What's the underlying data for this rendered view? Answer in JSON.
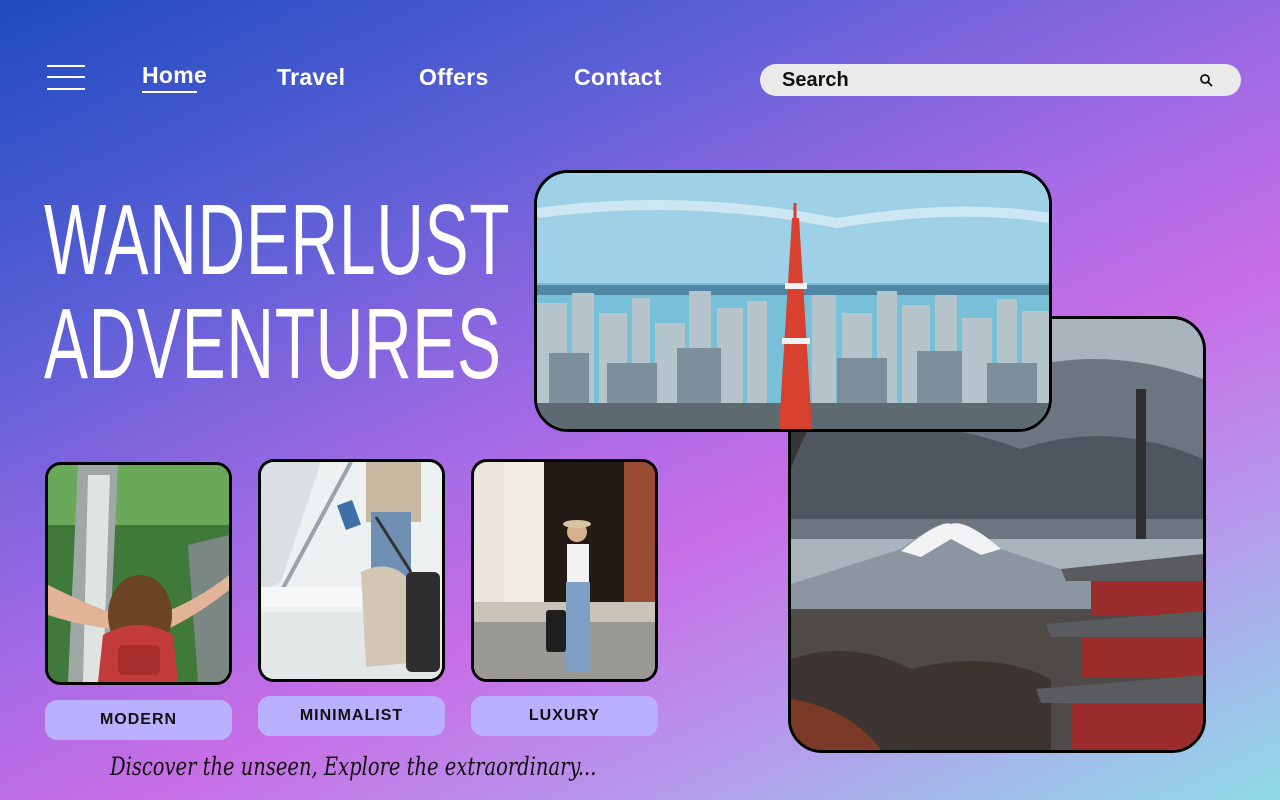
{
  "nav": {
    "items": [
      {
        "label": "Home",
        "active": true
      },
      {
        "label": "Travel",
        "active": false
      },
      {
        "label": "Offers",
        "active": false
      },
      {
        "label": "Contact",
        "active": false
      }
    ]
  },
  "search": {
    "placeholder": "Search",
    "icon": "search-icon"
  },
  "hero": {
    "line1": "WANDERLUST",
    "line2": "ADVENTURES"
  },
  "categories": [
    {
      "label": "MODERN",
      "image": "waterfall-traveler-photo"
    },
    {
      "label": "MINIMALIST",
      "image": "airport-luggage-photo"
    },
    {
      "label": "LUXURY",
      "image": "woman-with-suitcase-photo"
    }
  ],
  "photos": {
    "city": "tokyo-tower-skyline-photo",
    "fuji": "mount-fuji-pagoda-photo"
  },
  "tagline": "Discover the unseen, Explore the extraordinary...",
  "colors": {
    "label_bg": "#b9b0ff",
    "search_bg": "#ebebeb"
  }
}
